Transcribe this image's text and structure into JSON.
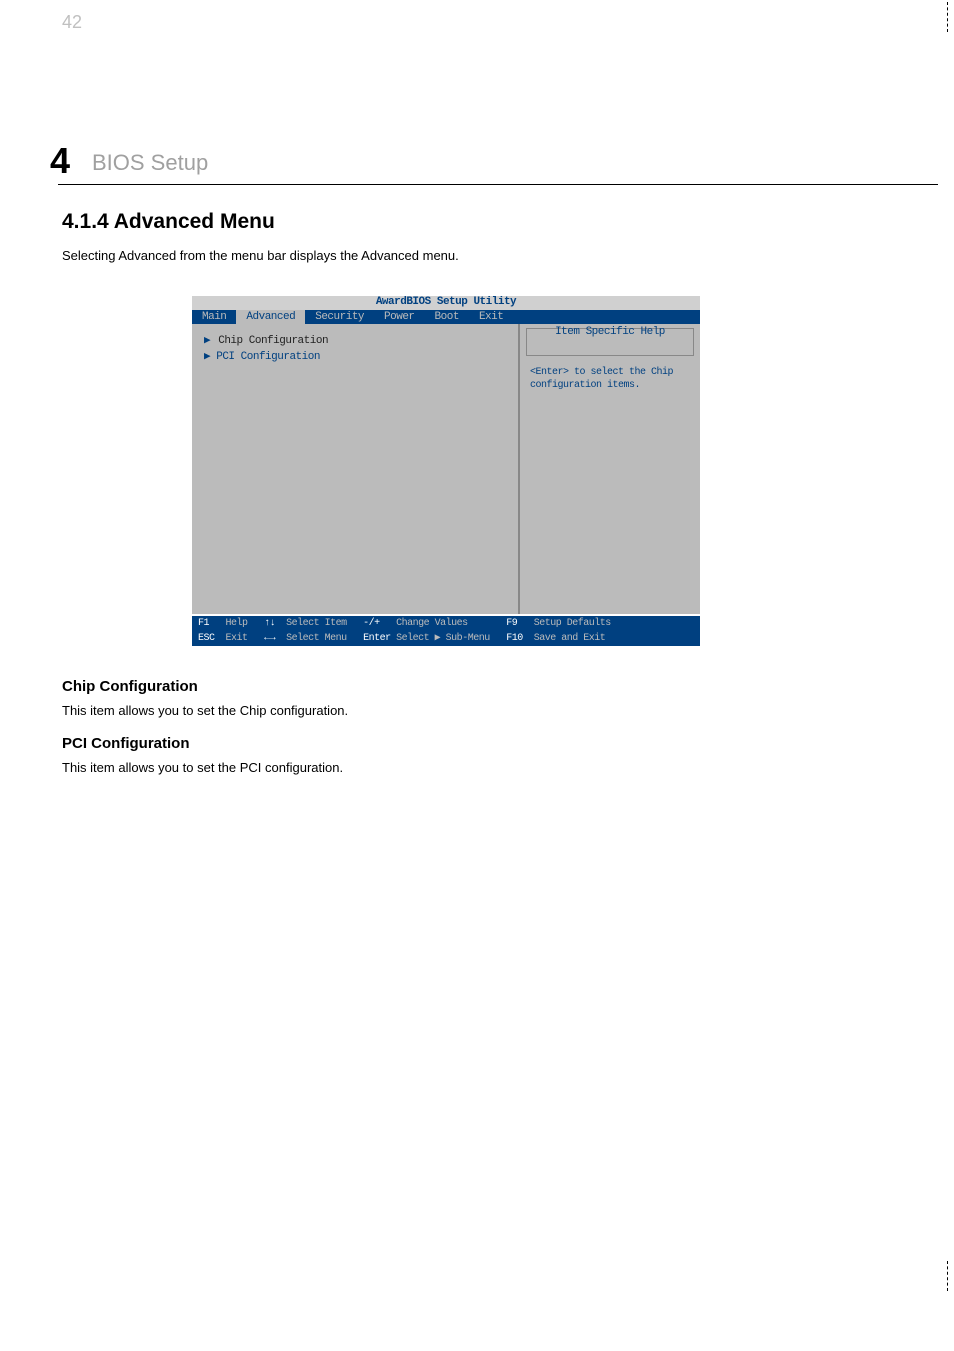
{
  "page_number": "42",
  "chapter_number": "4",
  "chapter_title": "BIOS Setup",
  "section_title": "4.1.4  Advanced Menu",
  "intro_text": "Selecting Advanced from the menu bar displays the Advanced menu.",
  "bios": {
    "title": "AwardBIOS Setup Utility",
    "tabs": [
      "Main",
      "Advanced",
      "Security",
      "Power",
      "Boot",
      "Exit"
    ],
    "active_tab": 1,
    "items": [
      "Chip Configuration",
      "PCI Configuration"
    ],
    "selected_item": 0,
    "help_title": "Item Specific Help",
    "help_text": "<Enter> to select the Chip configuration items.",
    "footer_line1_keys": [
      "F1",
      "↑↓",
      "-/+",
      "F9"
    ],
    "footer_line1_labels": [
      "Help",
      "Select Item",
      "Change Values",
      "Setup Defaults"
    ],
    "footer_line2_keys": [
      "ESC",
      "←→",
      "Enter",
      "F10"
    ],
    "footer_line2_labels": [
      "Exit",
      "Select Menu",
      "Select ▶ Sub-Menu",
      "Save and Exit"
    ]
  },
  "subsections": [
    {
      "title": "Chip Configuration",
      "text": "This item allows you to set the Chip configuration."
    },
    {
      "title": "PCI Configuration",
      "text": "This item allows you to set the PCI configuration."
    }
  ]
}
